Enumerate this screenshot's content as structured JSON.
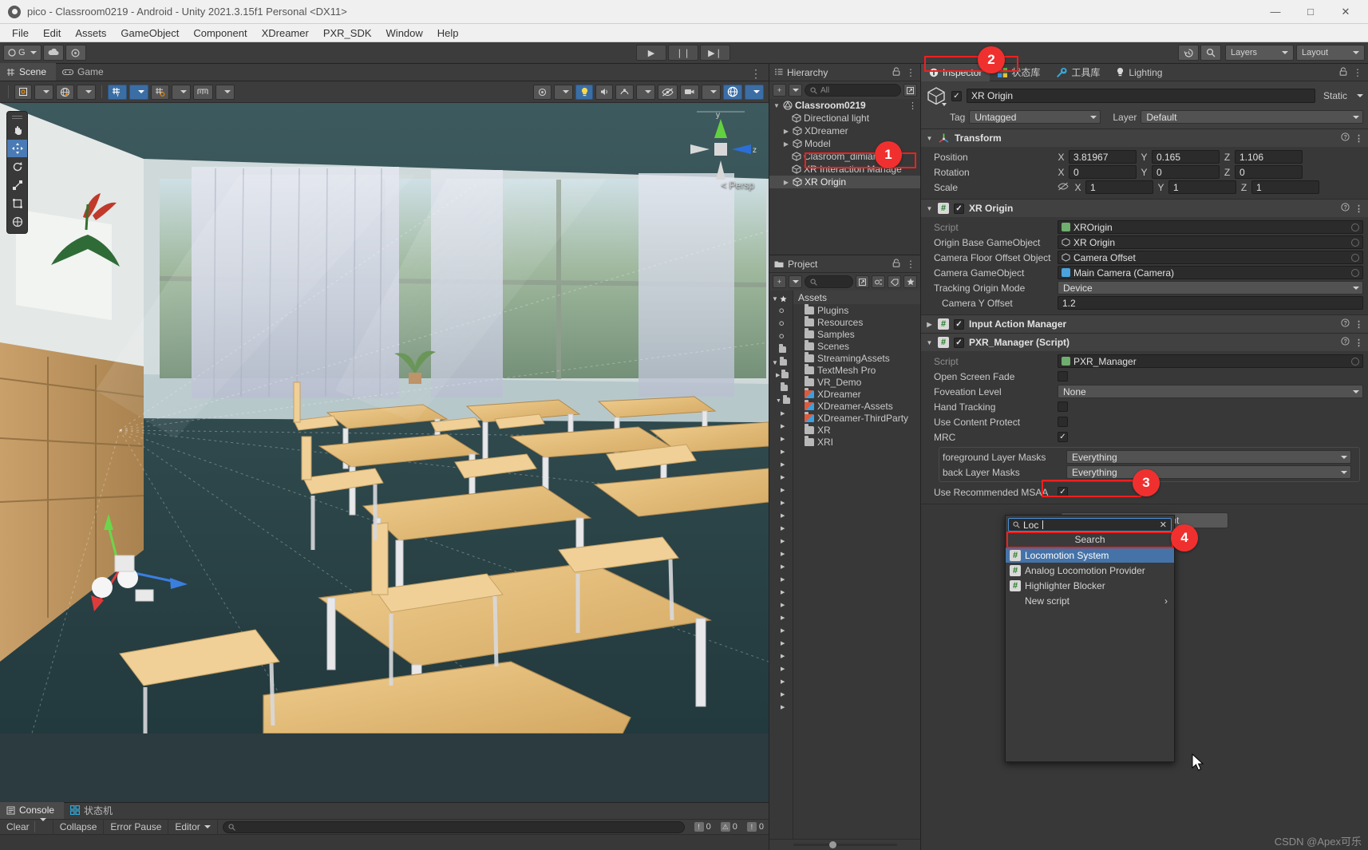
{
  "window": {
    "title": "pico - Classroom0219 - Android - Unity 2021.3.15f1 Personal <DX11>",
    "minimize": "—",
    "maximize": "□",
    "close": "✕"
  },
  "menubar": {
    "items": [
      "File",
      "Edit",
      "Assets",
      "GameObject",
      "Component",
      "XDreamer",
      "PXR_SDK",
      "Window",
      "Help"
    ]
  },
  "toolbar": {
    "account_label": "G",
    "play": "▶",
    "pause": "❘❘",
    "step": "▶❘",
    "history_icon": "history-icon",
    "search_icon": "search-icon",
    "layers_label": "Layers",
    "layout_label": "Layout"
  },
  "scene_panel": {
    "tabs": [
      {
        "label": "Scene",
        "icon": "grid-icon",
        "active": true
      },
      {
        "label": "Game",
        "icon": "gamepad-icon",
        "active": false
      }
    ],
    "persp_label": "Persp",
    "gizmo_axis_z": "z",
    "gizmo_axis_y": "y",
    "tool_palette": [
      "hand-tool",
      "move-tool",
      "rotate-tool",
      "scale-tool",
      "rect-tool",
      "transform-tool"
    ]
  },
  "console": {
    "tabs": [
      {
        "label": "Console",
        "active": true
      },
      {
        "label": "状态机",
        "active": false
      }
    ],
    "buttons": [
      "Clear",
      "Collapse",
      "Error Pause",
      "Editor"
    ],
    "search_placeholder": "",
    "counts": [
      {
        "type": "log",
        "value": "0"
      },
      {
        "type": "warning",
        "value": "0"
      },
      {
        "type": "error",
        "value": "0"
      }
    ]
  },
  "hierarchy": {
    "title": "Hierarchy",
    "search_placeholder": "All",
    "add_label": "+",
    "items": [
      {
        "label": "Classroom0219",
        "depth": 0,
        "arrow": "down",
        "icon": "unity-scene-icon",
        "selected": false,
        "more": "⋮"
      },
      {
        "label": "Directional light",
        "depth": 1,
        "arrow": "",
        "icon": "cube-icon",
        "selected": false
      },
      {
        "label": "XDreamer",
        "depth": 1,
        "arrow": "right",
        "icon": "cube-icon",
        "selected": false
      },
      {
        "label": "Model",
        "depth": 1,
        "arrow": "right",
        "icon": "cube-icon",
        "selected": false
      },
      {
        "label": "Clasroom_dimian",
        "depth": 1,
        "arrow": "",
        "icon": "cube-icon",
        "selected": false
      },
      {
        "label": "XR Interaction Manage",
        "depth": 1,
        "arrow": "",
        "icon": "cube-icon",
        "selected": false
      },
      {
        "label": "XR Origin",
        "depth": 1,
        "arrow": "right",
        "icon": "cube-icon",
        "selected": true
      }
    ]
  },
  "project": {
    "title": "Project",
    "add_label": "+",
    "search_placeholder": "",
    "assets_label": "Assets",
    "items": [
      {
        "label": "Plugins",
        "kind": "folder"
      },
      {
        "label": "Resources",
        "kind": "folder"
      },
      {
        "label": "Samples",
        "kind": "folder"
      },
      {
        "label": "Scenes",
        "kind": "folder"
      },
      {
        "label": "StreamingAssets",
        "kind": "folder"
      },
      {
        "label": "TextMesh Pro",
        "kind": "folder"
      },
      {
        "label": "VR_Demo",
        "kind": "folder"
      },
      {
        "label": "XDreamer",
        "kind": "package"
      },
      {
        "label": "XDreamer-Assets",
        "kind": "package"
      },
      {
        "label": "XDreamer-ThirdParty",
        "kind": "package"
      },
      {
        "label": "XR",
        "kind": "folder"
      },
      {
        "label": "XRI",
        "kind": "folder"
      }
    ]
  },
  "inspector": {
    "tabs": [
      {
        "label": "Inspector",
        "icon": "info-icon",
        "active": true
      },
      {
        "label": "状态库",
        "icon": "state-lib-icon",
        "active": false
      },
      {
        "label": "工具库",
        "icon": "wrench-icon",
        "active": false
      },
      {
        "label": "Lighting",
        "icon": "bulb-icon",
        "active": false
      }
    ],
    "gameobject": {
      "enabled_check": "✓",
      "name": "XR Origin",
      "static_label": "Static",
      "tag_label": "Tag",
      "tag_value": "Untagged",
      "layer_label": "Layer",
      "layer_value": "Default"
    },
    "components": [
      {
        "name": "Transform",
        "icon": "transform-icon",
        "expanded": true,
        "rows": [
          {
            "label": "Position",
            "x": "3.81967",
            "y": "0.165",
            "z": "1.106"
          },
          {
            "label": "Rotation",
            "x": "0",
            "y": "0",
            "z": "0"
          },
          {
            "label": "Scale",
            "x": "1",
            "y": "1",
            "z": "1",
            "link_icon": "unlink-icon"
          }
        ],
        "axis_labels": [
          "X",
          "Y",
          "Z"
        ],
        "help": "?",
        "menu": "⋮"
      },
      {
        "name": "XR Origin",
        "icon": "script-icon",
        "expanded": true,
        "enabled": true,
        "fields": [
          {
            "label": "Script",
            "value": "XROrigin",
            "type": "object-readonly",
            "icon_color": "#6fae6f"
          },
          {
            "label": "Origin Base GameObject",
            "value": "XR Origin",
            "type": "object",
            "icon": "cube"
          },
          {
            "label": "Camera Floor Offset Object",
            "value": "Camera Offset",
            "type": "object",
            "icon": "cube"
          },
          {
            "label": "Camera GameObject",
            "value": "Main Camera (Camera)",
            "type": "object",
            "icon": "camera",
            "icon_color": "#4aa3dd"
          },
          {
            "label": "Tracking Origin Mode",
            "value": "Device",
            "type": "dropdown"
          },
          {
            "label": "Camera Y Offset",
            "value": "1.2",
            "type": "number"
          }
        ]
      },
      {
        "name": "Input Action Manager",
        "icon": "script-icon",
        "expanded": false,
        "enabled": true,
        "fields": []
      },
      {
        "name": "PXR_Manager (Script)",
        "icon": "script-icon",
        "expanded": true,
        "enabled": true,
        "fields": [
          {
            "label": "Script",
            "value": "PXR_Manager",
            "type": "object-readonly",
            "icon_color": "#6fae6f"
          },
          {
            "label": "Open Screen Fade",
            "value": false,
            "type": "checkbox"
          },
          {
            "label": "Foveation Level",
            "value": "None",
            "type": "dropdown"
          },
          {
            "label": "Hand Tracking",
            "value": false,
            "type": "checkbox"
          },
          {
            "label": "Use Content Protect",
            "value": false,
            "type": "checkbox"
          },
          {
            "label": "MRC",
            "value": true,
            "type": "checkbox"
          }
        ],
        "grouped_fields": [
          {
            "label": "foreground Layer Masks",
            "value": "Everything",
            "type": "dropdown"
          },
          {
            "label": "back Layer Masks",
            "value": "Everything",
            "type": "dropdown"
          }
        ],
        "trailing_fields": [
          {
            "label": "Use Recommended MSAA",
            "value": true,
            "type": "checkbox"
          }
        ]
      }
    ],
    "add_component_label": "Add Component",
    "component_menu": {
      "search_value": "Loc",
      "search_icon": "search-icon",
      "clear_icon": "close-icon",
      "header": "Search",
      "items": [
        {
          "label": "Locomotion System",
          "icon": "script-icon",
          "selected": true
        },
        {
          "label": "Analog Locomotion Provider",
          "icon": "script-icon",
          "selected": false
        },
        {
          "label": "Highlighter Blocker",
          "icon": "script-icon",
          "selected": false
        },
        {
          "label": "New script",
          "icon": "",
          "selected": false,
          "submenu": "›"
        }
      ]
    }
  },
  "annotations": {
    "markers": [
      {
        "number": "1",
        "target": "hierarchy XR Origin row"
      },
      {
        "number": "2",
        "target": "Inspector tab"
      },
      {
        "number": "3",
        "target": "Add Component button"
      },
      {
        "number": "4",
        "target": "Locomotion System menu item"
      }
    ],
    "watermark": "CSDN @Apex可乐"
  },
  "colors": {
    "accent_red": "#f0302f",
    "selection_blue": "#4573a8",
    "panel_bg": "#383838",
    "header_bg": "#3c3c3c"
  }
}
